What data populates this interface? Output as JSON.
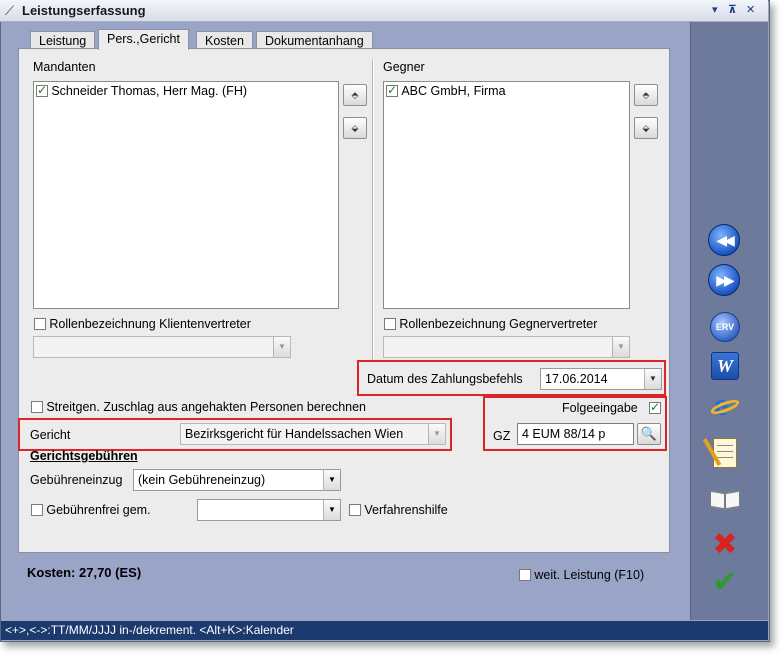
{
  "window": {
    "title": "Leistungserfassung"
  },
  "tabs": [
    {
      "label": "Leistung",
      "active": false
    },
    {
      "label": "Pers.,Gericht",
      "active": true
    },
    {
      "label": "Kosten",
      "active": false
    },
    {
      "label": "Dokumentanhang",
      "active": false
    }
  ],
  "mandanten": {
    "heading": "Mandanten",
    "items": [
      {
        "label": "Schneider Thomas, Herr Mag. (FH)",
        "checked": true
      }
    ],
    "role_checkbox_label": "Rollenbezeichnung Klientenvertreter",
    "role_value": ""
  },
  "gegner": {
    "heading": "Gegner",
    "items": [
      {
        "label": "ABC GmbH, Firma",
        "checked": true
      }
    ],
    "role_checkbox_label": "Rollenbezeichnung Gegnervertreter",
    "role_value": ""
  },
  "zahlungsbefehl": {
    "label": "Datum des Zahlungsbefehls",
    "value": "17.06.2014"
  },
  "streitgen": {
    "label": "Streitgen. Zuschlag aus angehakten Personen berechnen",
    "checked": false
  },
  "folgeeingabe": {
    "label": "Folgeeingabe",
    "checked": true
  },
  "gericht": {
    "label": "Gericht",
    "value": "Bezirksgericht für Handelssachen Wien"
  },
  "gz": {
    "label": "GZ",
    "value": "4 EUM 88/14 p"
  },
  "gerichtsgebuehren": {
    "heading": "Gerichtsgebühren",
    "einzug_label": "Gebühreneinzug",
    "einzug_value": "(kein Gebühreneinzug)",
    "frei_label": "Gebührenfrei gem.",
    "frei_value": "",
    "verfahrenshilfe_label": "Verfahrenshilfe"
  },
  "footer": {
    "kosten": "Kosten: 27,70 (ES)",
    "weit_leistung_label": "weit. Leistung (F10)"
  },
  "statusbar": {
    "text": "<+>,<->:TT/MM/JJJJ in-/dekrement. <Alt+K>:Kalender"
  },
  "sidebar_icons": [
    "rewind-icon",
    "fast-forward-icon",
    "erv-icon",
    "word-icon",
    "internet-explorer-icon",
    "notepad-icon",
    "book-icon",
    "cancel-icon",
    "confirm-icon"
  ],
  "sidebar_labels": {
    "erv": "ERV",
    "word": "W",
    "ie": "e"
  },
  "colors": {
    "window_frame": "#9aa4c6",
    "sidebar": "#6e7a9c",
    "status_bar": "#1c3a6e",
    "highlight_red": "#d8262b",
    "cancel_red": "#d9231f",
    "confirm_green": "#2e9a2e"
  }
}
